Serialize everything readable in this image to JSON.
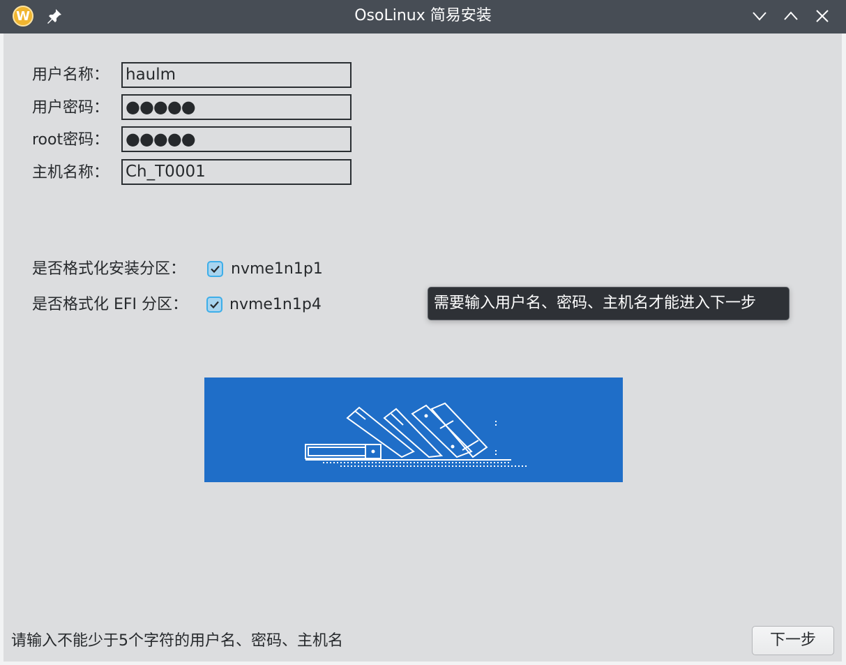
{
  "window": {
    "title": "OsoLinux 简易安装",
    "app_icon": "W",
    "icons": [
      "app-logo-icon",
      "pin-icon",
      "minimize-icon",
      "maximize-icon",
      "close-icon"
    ]
  },
  "form": {
    "username": {
      "label": "用户名称：",
      "value": "haulm"
    },
    "password": {
      "label": "用户密码：",
      "value": "●●●●●"
    },
    "root_password": {
      "label": "root密码：",
      "value": "●●●●●"
    },
    "hostname": {
      "label": "主机名称：",
      "value": "Ch_T0001"
    }
  },
  "options": {
    "format_install": {
      "label": "是否格式化安装分区：",
      "value": "nvme1n1p1",
      "checked": true
    },
    "format_efi": {
      "label": "是否格式化 EFI 分区：",
      "value": "nvme1n1p4",
      "checked": true
    }
  },
  "tooltip": {
    "text": "需要输入用户名、密码、主机名才能进入下一步"
  },
  "banner": {
    "color": "#1f6ec8",
    "icon": "books-illustration"
  },
  "status": {
    "text": "请输入不能少于5个字符的用户名、密码、主机名"
  },
  "next_button": {
    "label": "下一步"
  }
}
